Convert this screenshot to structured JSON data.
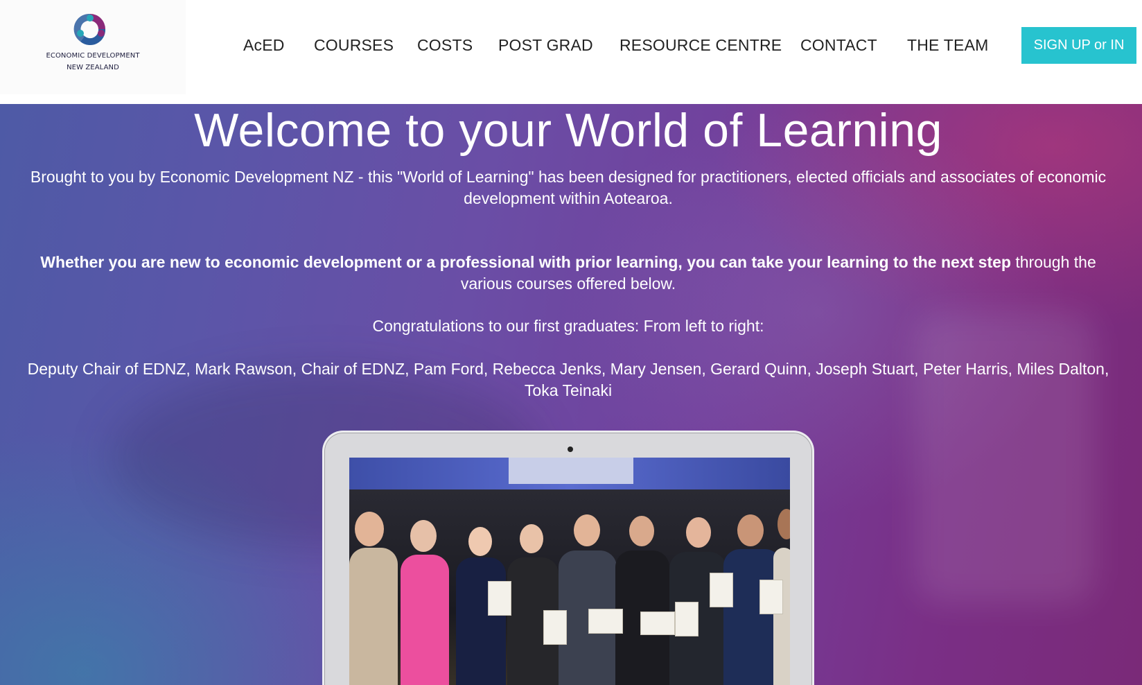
{
  "logo": {
    "line1": "ECONOMIC DEVELOPMENT",
    "line2": "NEW ZEALAND",
    "colors": {
      "blue": "#2a5c9e",
      "purple": "#8a2a7a",
      "teal": "#26a6b8"
    }
  },
  "nav": {
    "items": [
      {
        "label": "AcED"
      },
      {
        "label": "COURSES"
      },
      {
        "label": "COSTS"
      },
      {
        "label": "POST GRAD"
      },
      {
        "label": "RESOURCE CENTRE"
      },
      {
        "label": "CONTACT"
      },
      {
        "label": "THE TEAM"
      }
    ],
    "signup_label": "SIGN UP or IN",
    "signup_color": "#27c3cf"
  },
  "hero": {
    "title": "Welcome to your World of Learning",
    "intro": "Brought to  you by Economic Development NZ - this \"World of Learning\" has been designed for practitioners, elected officials and associates of economic development within Aotearoa.",
    "whether_bold": "Whether you are new to economic development  or a professional with prior learning, you  can take your learning to the next step",
    "whether_rest": " through the various courses offered below.",
    "congrats": "Congratulations to our first graduates: From left to right:",
    "graduates": "Deputy Chair of EDNZ, Mark Rawson, Chair of EDNZ, Pam Ford, Rebecca Jenks, Mary Jensen, Gerard Quinn, Joseph Stuart, Peter Harris, Miles Dalton, Toka Teinaki"
  }
}
